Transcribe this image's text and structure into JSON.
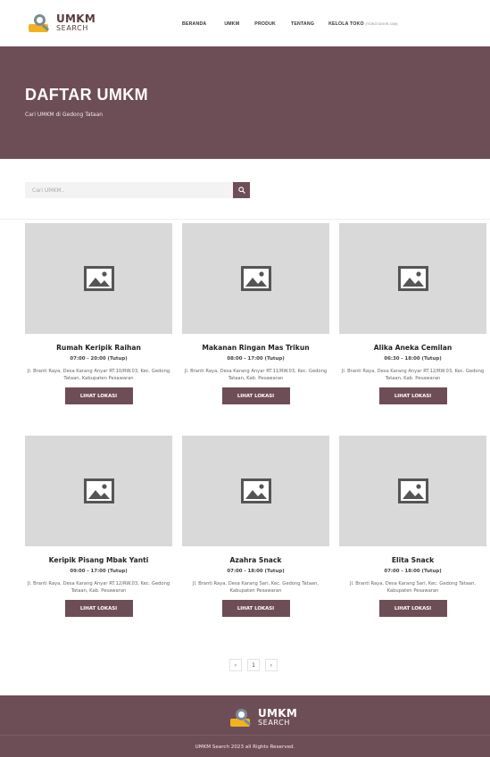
{
  "brand": {
    "line1": "UMKM",
    "line2": "SEARCH"
  },
  "nav": {
    "items": [
      {
        "label": "BERANDA"
      },
      {
        "label": "UMKM"
      },
      {
        "label": "PRODUK"
      },
      {
        "label": "TENTANG"
      },
      {
        "label": "KELOLA TOKO",
        "sub": "(TOKO DIVIS CW)"
      }
    ]
  },
  "hero": {
    "title": "DAFTAR UMKM",
    "subtitle": "Cari UMKM di Gedong Tataan"
  },
  "search": {
    "placeholder": "Cari UMKM.."
  },
  "cards": [
    {
      "name": "Rumah Keripik Raihan",
      "hours": "07:00 - 20:00 (Tutup)",
      "address": "Jl. Branti Raya, Desa Karang Anyar RT.10/RW.03, Kec. Gedong Tataan, Kabupaten Pesawaran",
      "button": "LIHAT LOKASI"
    },
    {
      "name": "Makanan Ringan Mas Trikun",
      "hours": "08:00 - 17:00 (Tutup)",
      "address": "Jl. Branti Raya, Desa Karang Anyar RT.11/RW.03, Kec. Gedong Tataan, Kab. Pesawaran",
      "button": "LIHAT LOKASI"
    },
    {
      "name": "Alika Aneka Cemilan",
      "hours": "06:30 - 18:00 (Tutup)",
      "address": "Jl. Branti Raya, Desa Karang Anyar RT.12/RW.03, Kec. Gedong Tataan, Kab. Pesawaran",
      "button": "LIHAT LOKASI"
    },
    {
      "name": "Keripik Pisang Mbak Yanti",
      "hours": "09:00 - 17:00 (Tutup)",
      "address": "Jl. Branti Raya, Desa Karang Anyar RT.12/RW.03, Kec. Gedong Tataan, Kab. Pesawaran",
      "button": "LIHAT LOKASI"
    },
    {
      "name": "Azahra Snack",
      "hours": "07:00 - 18:00 (Tutup)",
      "address": "Jl. Branti Raya, Desa Karang Sari, Kec. Gedong Tataan, Kabupaten Pesawaran",
      "button": "LIHAT LOKASI"
    },
    {
      "name": "Elita Snack",
      "hours": "07:00 - 18:00 (Tutup)",
      "address": "Jl. Branti Raya, Desa Karang Sari, Kec. Gedong Tataan, Kabupaten Pesawaran",
      "button": "LIHAT LOKASI"
    }
  ],
  "pagination": {
    "prev": "‹",
    "page": "1",
    "next": "›"
  },
  "footer": {
    "copyright": "UMKM Search 2023 all Rights Reserved."
  },
  "colors": {
    "primary": "#6e4e56",
    "placeholder_image": "#d9d9d9",
    "logo_accent": "#f2b21d"
  },
  "icons": {
    "search": "search-icon",
    "image_placeholder": "image-placeholder-icon",
    "logo": "magnifier-logo-icon"
  }
}
